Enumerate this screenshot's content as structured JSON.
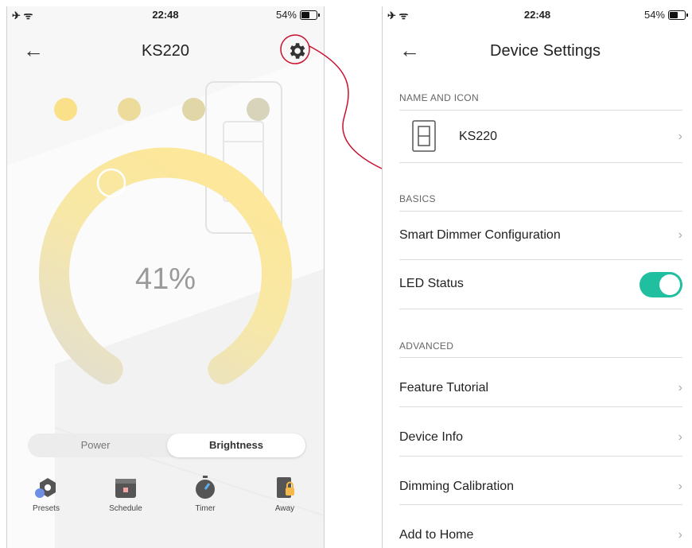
{
  "left": {
    "status": {
      "time": "22:48",
      "battery": "54%"
    },
    "title": "KS220",
    "brightness": "41%",
    "dots": [
      "#fbe08a",
      "#eddb9c",
      "#e0d6a8",
      "#d8d3bb"
    ],
    "tabs": {
      "power": "Power",
      "brightness": "Brightness",
      "active": "Brightness"
    },
    "nav": {
      "presets": "Presets",
      "schedule": "Schedule",
      "timer": "Timer",
      "away": "Away"
    }
  },
  "right": {
    "status": {
      "time": "22:48",
      "battery": "54%"
    },
    "title": "Device Settings",
    "sections": {
      "name_icon": "NAME AND ICON",
      "basics": "BASICS",
      "advanced": "ADVANCED"
    },
    "device_name": "KS220",
    "items": {
      "smart_dimmer": "Smart Dimmer Configuration",
      "led_status": "LED Status",
      "feature_tutorial": "Feature Tutorial",
      "device_info": "Device Info",
      "dimming_calibration": "Dimming Calibration",
      "add_to_home": "Add to Home"
    },
    "led_status_on": true
  },
  "colors": {
    "accent_toggle": "#1fbf9f",
    "highlight_ring": "#c8102e",
    "arc_light": "#fce79a",
    "arc_dim": "#e3dfcf"
  }
}
